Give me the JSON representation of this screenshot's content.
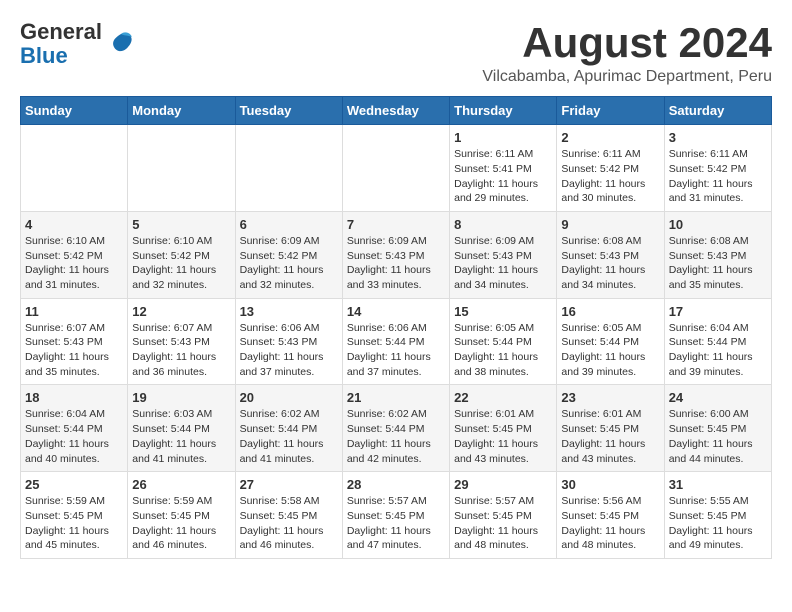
{
  "header": {
    "logo_line1": "General",
    "logo_line2": "Blue",
    "main_title": "August 2024",
    "subtitle": "Vilcabamba, Apurimac Department, Peru"
  },
  "calendar": {
    "days_of_week": [
      "Sunday",
      "Monday",
      "Tuesday",
      "Wednesday",
      "Thursday",
      "Friday",
      "Saturday"
    ],
    "weeks": [
      [
        {
          "day": "",
          "info": ""
        },
        {
          "day": "",
          "info": ""
        },
        {
          "day": "",
          "info": ""
        },
        {
          "day": "",
          "info": ""
        },
        {
          "day": "1",
          "info": "Sunrise: 6:11 AM\nSunset: 5:41 PM\nDaylight: 11 hours\nand 29 minutes."
        },
        {
          "day": "2",
          "info": "Sunrise: 6:11 AM\nSunset: 5:42 PM\nDaylight: 11 hours\nand 30 minutes."
        },
        {
          "day": "3",
          "info": "Sunrise: 6:11 AM\nSunset: 5:42 PM\nDaylight: 11 hours\nand 31 minutes."
        }
      ],
      [
        {
          "day": "4",
          "info": "Sunrise: 6:10 AM\nSunset: 5:42 PM\nDaylight: 11 hours\nand 31 minutes."
        },
        {
          "day": "5",
          "info": "Sunrise: 6:10 AM\nSunset: 5:42 PM\nDaylight: 11 hours\nand 32 minutes."
        },
        {
          "day": "6",
          "info": "Sunrise: 6:09 AM\nSunset: 5:42 PM\nDaylight: 11 hours\nand 32 minutes."
        },
        {
          "day": "7",
          "info": "Sunrise: 6:09 AM\nSunset: 5:43 PM\nDaylight: 11 hours\nand 33 minutes."
        },
        {
          "day": "8",
          "info": "Sunrise: 6:09 AM\nSunset: 5:43 PM\nDaylight: 11 hours\nand 34 minutes."
        },
        {
          "day": "9",
          "info": "Sunrise: 6:08 AM\nSunset: 5:43 PM\nDaylight: 11 hours\nand 34 minutes."
        },
        {
          "day": "10",
          "info": "Sunrise: 6:08 AM\nSunset: 5:43 PM\nDaylight: 11 hours\nand 35 minutes."
        }
      ],
      [
        {
          "day": "11",
          "info": "Sunrise: 6:07 AM\nSunset: 5:43 PM\nDaylight: 11 hours\nand 35 minutes."
        },
        {
          "day": "12",
          "info": "Sunrise: 6:07 AM\nSunset: 5:43 PM\nDaylight: 11 hours\nand 36 minutes."
        },
        {
          "day": "13",
          "info": "Sunrise: 6:06 AM\nSunset: 5:43 PM\nDaylight: 11 hours\nand 37 minutes."
        },
        {
          "day": "14",
          "info": "Sunrise: 6:06 AM\nSunset: 5:44 PM\nDaylight: 11 hours\nand 37 minutes."
        },
        {
          "day": "15",
          "info": "Sunrise: 6:05 AM\nSunset: 5:44 PM\nDaylight: 11 hours\nand 38 minutes."
        },
        {
          "day": "16",
          "info": "Sunrise: 6:05 AM\nSunset: 5:44 PM\nDaylight: 11 hours\nand 39 minutes."
        },
        {
          "day": "17",
          "info": "Sunrise: 6:04 AM\nSunset: 5:44 PM\nDaylight: 11 hours\nand 39 minutes."
        }
      ],
      [
        {
          "day": "18",
          "info": "Sunrise: 6:04 AM\nSunset: 5:44 PM\nDaylight: 11 hours\nand 40 minutes."
        },
        {
          "day": "19",
          "info": "Sunrise: 6:03 AM\nSunset: 5:44 PM\nDaylight: 11 hours\nand 41 minutes."
        },
        {
          "day": "20",
          "info": "Sunrise: 6:02 AM\nSunset: 5:44 PM\nDaylight: 11 hours\nand 41 minutes."
        },
        {
          "day": "21",
          "info": "Sunrise: 6:02 AM\nSunset: 5:44 PM\nDaylight: 11 hours\nand 42 minutes."
        },
        {
          "day": "22",
          "info": "Sunrise: 6:01 AM\nSunset: 5:45 PM\nDaylight: 11 hours\nand 43 minutes."
        },
        {
          "day": "23",
          "info": "Sunrise: 6:01 AM\nSunset: 5:45 PM\nDaylight: 11 hours\nand 43 minutes."
        },
        {
          "day": "24",
          "info": "Sunrise: 6:00 AM\nSunset: 5:45 PM\nDaylight: 11 hours\nand 44 minutes."
        }
      ],
      [
        {
          "day": "25",
          "info": "Sunrise: 5:59 AM\nSunset: 5:45 PM\nDaylight: 11 hours\nand 45 minutes."
        },
        {
          "day": "26",
          "info": "Sunrise: 5:59 AM\nSunset: 5:45 PM\nDaylight: 11 hours\nand 46 minutes."
        },
        {
          "day": "27",
          "info": "Sunrise: 5:58 AM\nSunset: 5:45 PM\nDaylight: 11 hours\nand 46 minutes."
        },
        {
          "day": "28",
          "info": "Sunrise: 5:57 AM\nSunset: 5:45 PM\nDaylight: 11 hours\nand 47 minutes."
        },
        {
          "day": "29",
          "info": "Sunrise: 5:57 AM\nSunset: 5:45 PM\nDaylight: 11 hours\nand 48 minutes."
        },
        {
          "day": "30",
          "info": "Sunrise: 5:56 AM\nSunset: 5:45 PM\nDaylight: 11 hours\nand 48 minutes."
        },
        {
          "day": "31",
          "info": "Sunrise: 5:55 AM\nSunset: 5:45 PM\nDaylight: 11 hours\nand 49 minutes."
        }
      ]
    ]
  }
}
